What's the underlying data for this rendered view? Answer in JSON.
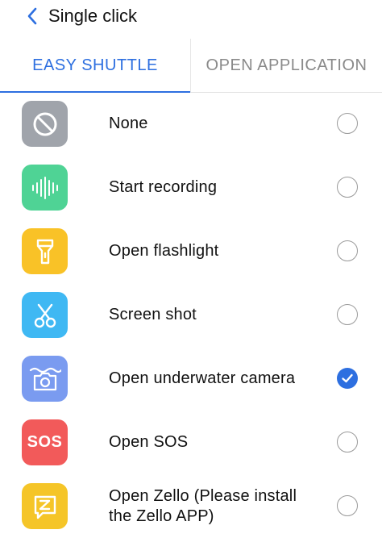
{
  "header": {
    "title": "Single click",
    "back_icon": "chevron-left-icon"
  },
  "tabs": [
    {
      "label": "EASY SHUTTLE",
      "active": true
    },
    {
      "label": "OPEN APPLICATION",
      "active": false
    }
  ],
  "colors": {
    "accent": "#2d6fe0",
    "none_icon_bg": "#a0a4ab",
    "recording_icon_bg": "#4fd395",
    "flashlight_icon_bg": "#f9c227",
    "screenshot_icon_bg": "#3fb8f3",
    "camera_icon_bg": "#7a9bf0",
    "sos_icon_bg": "#f25a5a",
    "zello_icon_bg": "#f5c528"
  },
  "options": [
    {
      "label": "None",
      "icon": "block-icon",
      "selected": false
    },
    {
      "label": "Start recording",
      "icon": "sound-wave-icon",
      "selected": false
    },
    {
      "label": "Open flashlight",
      "icon": "flashlight-icon",
      "selected": false
    },
    {
      "label": "Screen shot",
      "icon": "scissors-icon",
      "selected": false
    },
    {
      "label": "Open underwater camera",
      "icon": "underwater-camera-icon",
      "selected": true
    },
    {
      "label": "Open SOS",
      "icon": "sos-icon",
      "icon_text": "SOS",
      "selected": false
    },
    {
      "label_line1": "Open Zello (Please install",
      "label_line2": "the Zello APP)",
      "icon": "zello-icon",
      "selected": false
    }
  ]
}
